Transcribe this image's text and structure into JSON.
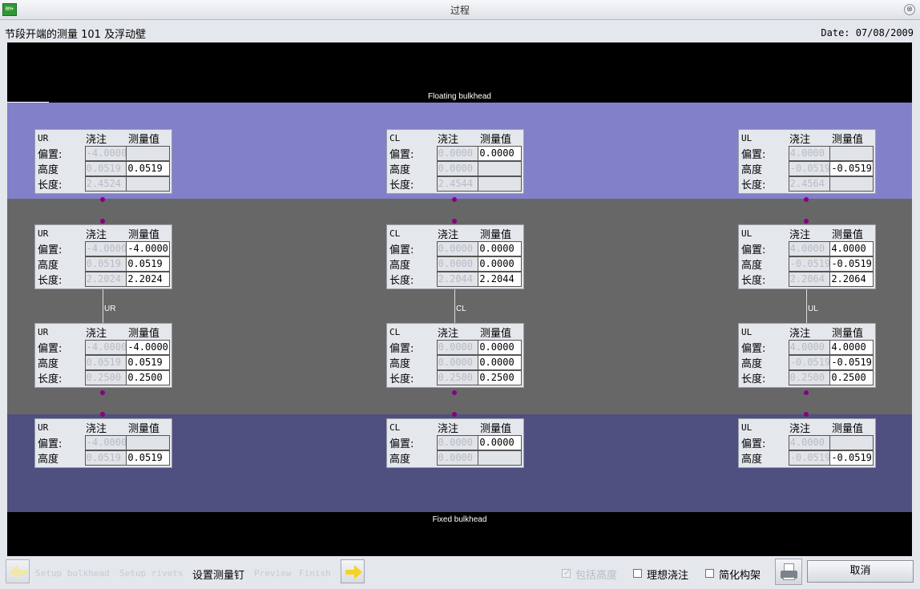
{
  "window": {
    "app_icon_text": "RM+",
    "title": "过程",
    "close_glyph": "⊗"
  },
  "header": {
    "title": "节段开端的测量 101 及浮动壁",
    "date": "Date: 07/08/2009"
  },
  "canvas": {
    "floating_label": "Floating bulkhead",
    "fixed_label": "Fixed bulkhead"
  },
  "connector_labels": {
    "ur": "UR",
    "cl": "CL",
    "ul": "UL"
  },
  "panels": [
    {
      "id": "ur-1",
      "tag": "UR",
      "col1": "浇注",
      "col2": "测量值",
      "rows": [
        {
          "label": "偏置:",
          "cast": "-4.0000",
          "measured": ""
        },
        {
          "label": "高度",
          "cast": "0.0519",
          "measured": "0.0519"
        },
        {
          "label": "长度:",
          "cast": "2.4524",
          "measured": ""
        }
      ]
    },
    {
      "id": "cl-1",
      "tag": "CL",
      "col1": "浇注",
      "col2": "测量值",
      "rows": [
        {
          "label": "偏置:",
          "cast": "0.0000",
          "measured": "0.0000"
        },
        {
          "label": "高度",
          "cast": "0.0000",
          "measured": ""
        },
        {
          "label": "长度:",
          "cast": "2.4544",
          "measured": ""
        }
      ]
    },
    {
      "id": "ul-1",
      "tag": "UL",
      "col1": "浇注",
      "col2": "测量值",
      "rows": [
        {
          "label": "偏置:",
          "cast": "4.0000",
          "measured": ""
        },
        {
          "label": "高度",
          "cast": "-0.0519",
          "measured": "-0.0519"
        },
        {
          "label": "长度:",
          "cast": "2.4564",
          "measured": ""
        }
      ]
    },
    {
      "id": "ur-2",
      "tag": "UR",
      "col1": "浇注",
      "col2": "测量值",
      "rows": [
        {
          "label": "偏置:",
          "cast": "-4.0000",
          "measured": "-4.0000"
        },
        {
          "label": "高度",
          "cast": "0.0519",
          "measured": "0.0519"
        },
        {
          "label": "长度:",
          "cast": "2.2024",
          "measured": "2.2024"
        }
      ]
    },
    {
      "id": "cl-2",
      "tag": "CL",
      "col1": "浇注",
      "col2": "测量值",
      "rows": [
        {
          "label": "偏置:",
          "cast": "0.0000",
          "measured": "0.0000"
        },
        {
          "label": "高度",
          "cast": "0.0000",
          "measured": "0.0000"
        },
        {
          "label": "长度:",
          "cast": "2.2044",
          "measured": "2.2044"
        }
      ]
    },
    {
      "id": "ul-2",
      "tag": "UL",
      "col1": "浇注",
      "col2": "测量值",
      "rows": [
        {
          "label": "偏置:",
          "cast": "4.0000",
          "measured": "4.0000"
        },
        {
          "label": "高度",
          "cast": "-0.0519",
          "measured": "-0.0519"
        },
        {
          "label": "长度:",
          "cast": "2.2064",
          "measured": "2.2064"
        }
      ]
    },
    {
      "id": "ur-3",
      "tag": "UR",
      "col1": "浇注",
      "col2": "测量值",
      "rows": [
        {
          "label": "偏置:",
          "cast": "-4.0000",
          "measured": "-4.0000"
        },
        {
          "label": "高度",
          "cast": "0.0519",
          "measured": "0.0519"
        },
        {
          "label": "长度:",
          "cast": "0.2500",
          "measured": "0.2500"
        }
      ]
    },
    {
      "id": "cl-3",
      "tag": "CL",
      "col1": "浇注",
      "col2": "测量值",
      "rows": [
        {
          "label": "偏置:",
          "cast": "0.0000",
          "measured": "0.0000"
        },
        {
          "label": "高度",
          "cast": "0.0000",
          "measured": "0.0000"
        },
        {
          "label": "长度:",
          "cast": "0.2500",
          "measured": "0.2500"
        }
      ]
    },
    {
      "id": "ul-3",
      "tag": "UL",
      "col1": "浇注",
      "col2": "测量值",
      "rows": [
        {
          "label": "偏置:",
          "cast": "4.0000",
          "measured": "4.0000"
        },
        {
          "label": "高度",
          "cast": "-0.0519",
          "measured": "-0.0519"
        },
        {
          "label": "长度:",
          "cast": "0.2500",
          "measured": "0.2500"
        }
      ]
    },
    {
      "id": "ur-4",
      "tag": "UR",
      "col1": "浇注",
      "col2": "测量值",
      "rows": [
        {
          "label": "偏置:",
          "cast": "-4.0000",
          "measured": ""
        },
        {
          "label": "高度",
          "cast": "0.0519",
          "measured": "0.0519"
        }
      ]
    },
    {
      "id": "cl-4",
      "tag": "CL",
      "col1": "浇注",
      "col2": "测量值",
      "rows": [
        {
          "label": "偏置:",
          "cast": "0.0000",
          "measured": "0.0000"
        },
        {
          "label": "高度",
          "cast": "0.0000",
          "measured": ""
        }
      ]
    },
    {
      "id": "ul-4",
      "tag": "UL",
      "col1": "浇注",
      "col2": "测量值",
      "rows": [
        {
          "label": "偏置:",
          "cast": "4.0000",
          "measured": ""
        },
        {
          "label": "高度",
          "cast": "-0.0519",
          "measured": "-0.0519"
        }
      ]
    }
  ],
  "toolbar": {
    "steps": [
      "Setup bulkhead",
      "Setup rivets",
      "设置测量钉",
      "Preview",
      "Finish"
    ],
    "active_step": 2,
    "checkboxes": [
      {
        "label": "包括高度",
        "checked": true,
        "disabled": true
      },
      {
        "label": "理想浇注",
        "checked": false,
        "disabled": false
      },
      {
        "label": "简化构架",
        "checked": false,
        "disabled": false
      }
    ],
    "cancel_label": "取消",
    "print_icon": "printer-icon",
    "arrow_color": "#f3d424"
  }
}
